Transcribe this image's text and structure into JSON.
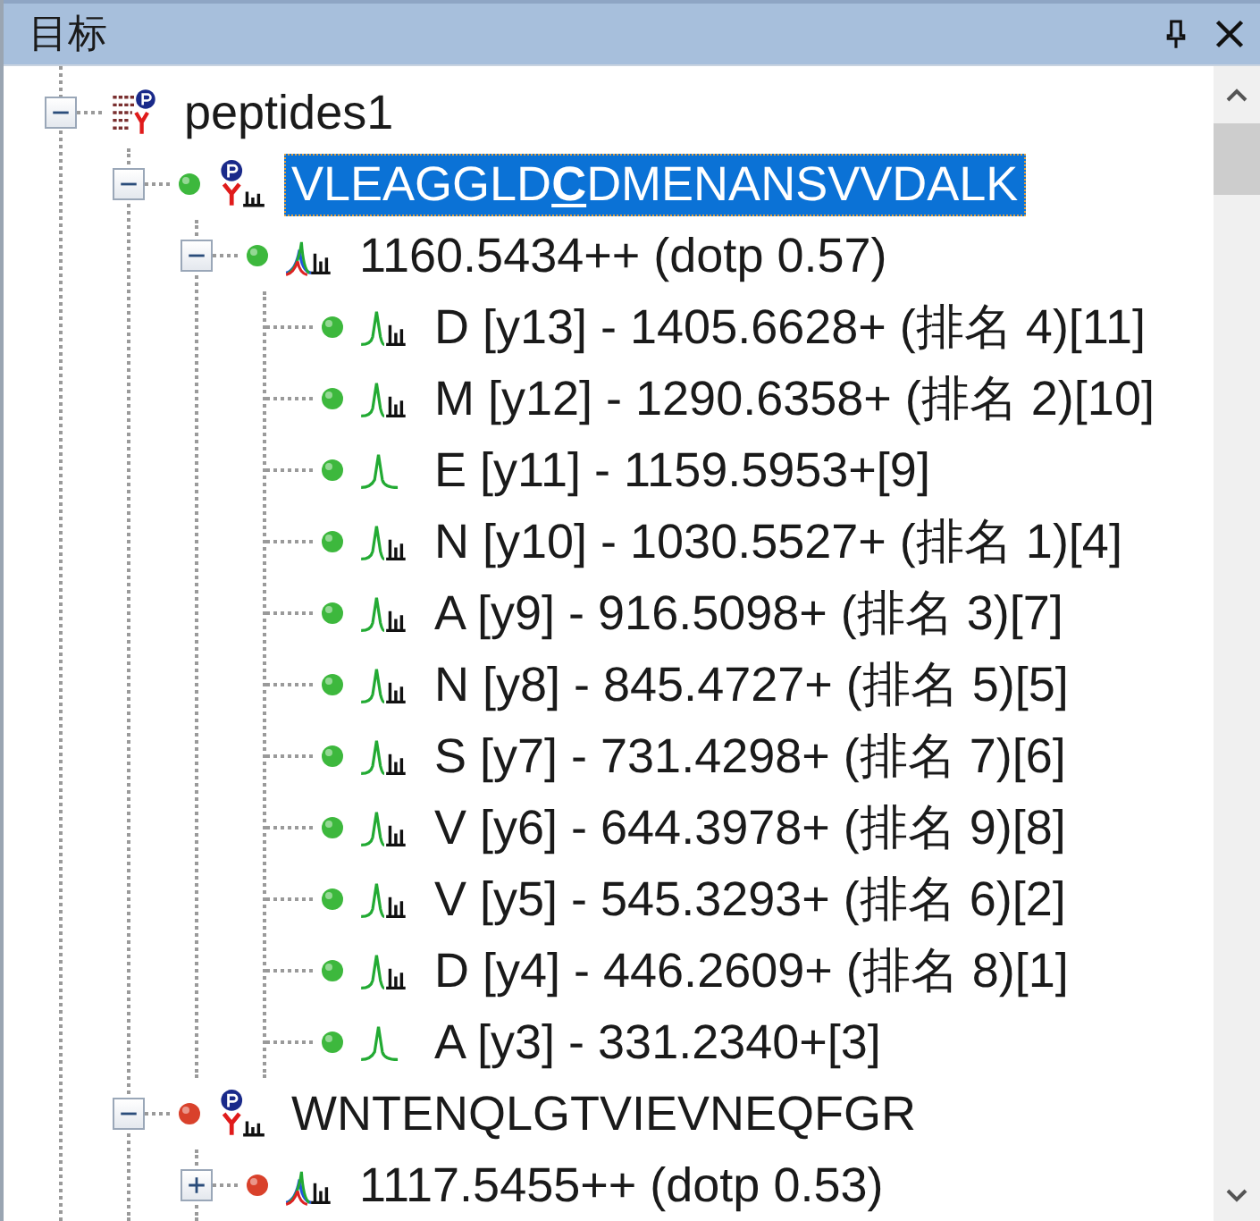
{
  "panel": {
    "title": "目标"
  },
  "tree": [
    {
      "kind": "document",
      "label": "peptides1",
      "expanded": true,
      "selected": false,
      "children": [
        {
          "kind": "peptide",
          "label": "VLEAGGLD**C**DMENANSVVDALK",
          "color": "#3db83d",
          "selected": true,
          "expanded": true,
          "children": [
            {
              "kind": "precursor",
              "label": "1160.5434++ (dotp 0.57)",
              "color": "#3db83d",
              "selected": false,
              "expanded": true,
              "children": [
                {
                  "kind": "transition",
                  "label": "D [y13] - 1405.6628+ (排名 4)[11]",
                  "color": "#3db83d",
                  "ranked": true,
                  "selected": false
                },
                {
                  "kind": "transition",
                  "label": "M [y12] - 1290.6358+ (排名 2)[10]",
                  "color": "#3db83d",
                  "ranked": true,
                  "selected": false
                },
                {
                  "kind": "transition",
                  "label": "E [y11] - 1159.5953+[9]",
                  "color": "#3db83d",
                  "ranked": false,
                  "selected": false
                },
                {
                  "kind": "transition",
                  "label": "N [y10] - 1030.5527+ (排名 1)[4]",
                  "color": "#3db83d",
                  "ranked": true,
                  "selected": false
                },
                {
                  "kind": "transition",
                  "label": "A [y9] - 916.5098+ (排名 3)[7]",
                  "color": "#3db83d",
                  "ranked": true,
                  "selected": false
                },
                {
                  "kind": "transition",
                  "label": "N [y8] - 845.4727+ (排名 5)[5]",
                  "color": "#3db83d",
                  "ranked": true,
                  "selected": false
                },
                {
                  "kind": "transition",
                  "label": "S [y7] - 731.4298+ (排名 7)[6]",
                  "color": "#3db83d",
                  "ranked": true,
                  "selected": false
                },
                {
                  "kind": "transition",
                  "label": "V [y6] - 644.3978+ (排名 9)[8]",
                  "color": "#3db83d",
                  "ranked": true,
                  "selected": false
                },
                {
                  "kind": "transition",
                  "label": "V [y5] - 545.3293+ (排名 6)[2]",
                  "color": "#3db83d",
                  "ranked": true,
                  "selected": false
                },
                {
                  "kind": "transition",
                  "label": "D [y4] - 446.2609+ (排名 8)[1]",
                  "color": "#3db83d",
                  "ranked": true,
                  "selected": false
                },
                {
                  "kind": "transition",
                  "label": "A [y3] - 331.2340+[3]",
                  "color": "#3db83d",
                  "ranked": false,
                  "selected": false
                }
              ]
            }
          ]
        },
        {
          "kind": "peptide",
          "label": "WNTENQLGTVIEVNEQFGR",
          "color": "#d9412b",
          "selected": false,
          "expanded": true,
          "children": [
            {
              "kind": "precursor",
              "label": "1117.5455++ (dotp 0.53)",
              "color": "#d9412b",
              "selected": false,
              "expanded": false
            }
          ]
        }
      ]
    }
  ]
}
